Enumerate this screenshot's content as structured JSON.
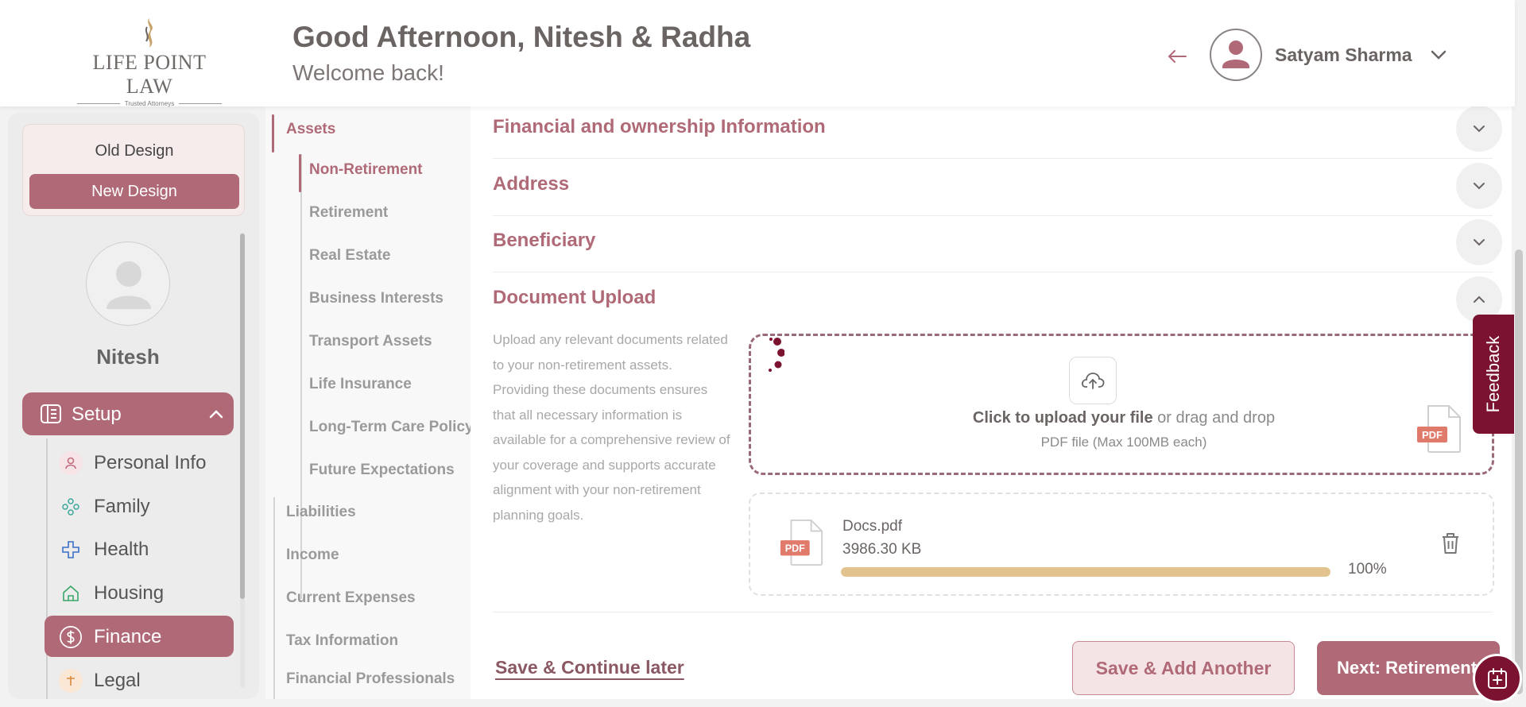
{
  "header": {
    "brand": "LIFE POINT LAW",
    "tagline": "Trusted Attorneys",
    "greeting": "Good Afternoon, Nitesh & Radha",
    "welcome": "Welcome back!",
    "user_name": "Satyam Sharma"
  },
  "sidebar": {
    "old_design": "Old Design",
    "new_design": "New Design",
    "profile_name": "Nitesh",
    "setup_label": "Setup",
    "items": [
      {
        "label": "Personal Info",
        "icon": "person-icon"
      },
      {
        "label": "Family",
        "icon": "family-icon"
      },
      {
        "label": "Health",
        "icon": "health-cross-icon"
      },
      {
        "label": "Housing",
        "icon": "house-icon"
      },
      {
        "label": "Finance",
        "icon": "dollar-icon",
        "active": true
      },
      {
        "label": "Legal",
        "icon": "legal-icon"
      }
    ]
  },
  "subnav": {
    "assets": "Assets",
    "asset_items": [
      "Non-Retirement",
      "Retirement",
      "Real Estate",
      "Business Interests",
      "Transport Assets",
      "Life Insurance",
      "Long-Term Care Policy",
      "Future Expectations"
    ],
    "top_items": [
      "Liabilities",
      "Income",
      "Current Expenses",
      "Tax Information",
      "Financial Professionals"
    ]
  },
  "main": {
    "sections": [
      "Financial and ownership Information",
      "Address",
      "Beneficiary",
      "Document Upload"
    ],
    "description": "Upload any relevant documents related to your non-retirement assets. Providing these documents ensures that all necessary information is available for a comprehensive review of your coverage and supports accurate alignment with your non-retirement planning goals.",
    "upload": {
      "click_text": "Click to upload your file",
      "drag_text": " or drag and drop",
      "hint": "PDF file (Max 100MB each)"
    },
    "file": {
      "name": "Docs.pdf",
      "size": "3986.30 KB",
      "progress_pct": "100%",
      "progress_fraction": 1.0
    },
    "save_later": "Save & Continue later",
    "save_add": "Save & Add Another",
    "next": "Next: Retirement"
  },
  "feedback_label": "Feedback",
  "colors": {
    "accent": "#b06a77",
    "dark_accent": "#7b1330",
    "progress": "#e2c28e"
  }
}
